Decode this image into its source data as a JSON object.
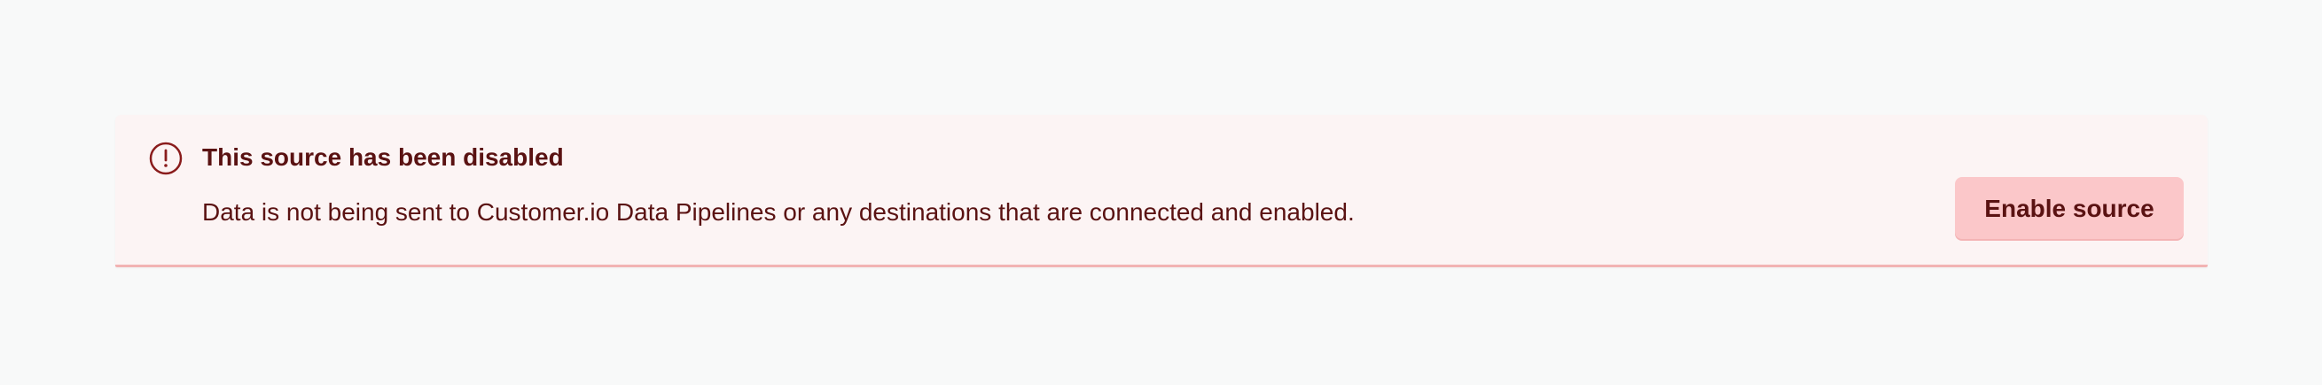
{
  "alert": {
    "icon": "exclamation-circle-icon",
    "title": "This source has been disabled",
    "message": "Data is not being sent to Customer.io Data Pipelines or any destinations that are connected and enabled.",
    "button_label": "Enable source"
  },
  "colors": {
    "page_background": "#f8f9f9",
    "alert_background": "#fcf4f4",
    "alert_border": "#f2b3b3",
    "text": "#5a1212",
    "button_background": "#fbc7c9",
    "icon": "#8a1c1c"
  }
}
